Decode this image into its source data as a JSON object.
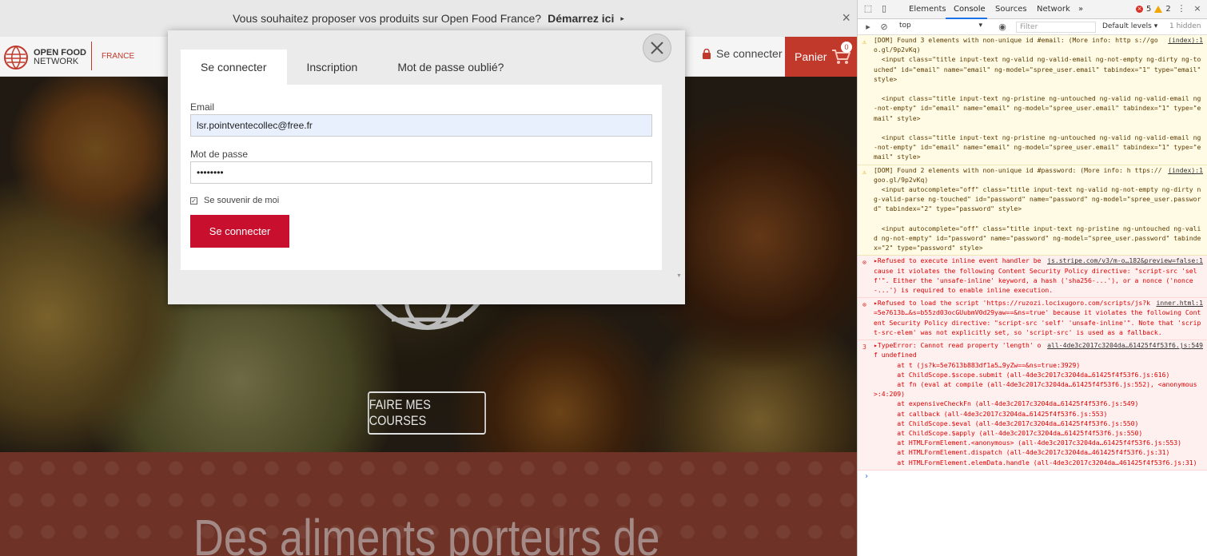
{
  "site": {
    "banner": {
      "text": "Vous souhaitez proposer vos produits sur Open Food France?",
      "cta": "Démarrez ici",
      "arrow": "▸",
      "close": "×"
    },
    "logo": {
      "line1": "OPEN FOOD",
      "line2": "NETWORK"
    },
    "country": "FRANCE",
    "login_link": "Se connecter",
    "cart": {
      "label": "Panier",
      "count": "0"
    },
    "hero_cta": "FAIRE MES COURSES",
    "tagline": "Des aliments porteurs de"
  },
  "modal": {
    "tabs": [
      "Se connecter",
      "Inscription",
      "Mot de passe oublié?"
    ],
    "active_tab": 0,
    "email_label": "Email",
    "email_value": "lsr.pointventecollec@free.fr",
    "password_label": "Mot de passe",
    "password_value": "••••••••",
    "remember_label": "Se souvenir de moi",
    "remember_checked": true,
    "submit_label": "Se connecter"
  },
  "devtools": {
    "tabs": [
      "Elements",
      "Console",
      "Sources",
      "Network",
      "»"
    ],
    "active_tab": "Console",
    "errors_count": "5",
    "warnings_count": "2",
    "context": "top",
    "filter_placeholder": "Filter",
    "levels": "Default levels ▾",
    "hidden": "1 hidden",
    "messages": [
      {
        "type": "warn",
        "icon": "⚠",
        "source": "(index):1",
        "text": "[DOM] Found 3 elements with non-unique id #email: (More info: http s://goo.gl/9p2vKq)\n  <input class=\"title input-text ng-valid ng-valid-email ng-not-empty ng-dirty ng-touched\" id=\"email\" name=\"email\" ng-model=\"spree_user.email\" tabindex=\"1\" type=\"email\" style>\n\n  <input class=\"title input-text ng-pristine ng-untouched ng-valid ng-valid-email ng-not-empty\" id=\"email\" name=\"email\" ng-model=\"spree_user.email\" tabindex=\"1\" type=\"email\" style>\n\n  <input class=\"title input-text ng-pristine ng-untouched ng-valid ng-valid-email ng-not-empty\" id=\"email\" name=\"email\" ng-model=\"spree_user.email\" tabindex=\"1\" type=\"email\" style>"
      },
      {
        "type": "warn",
        "icon": "⚠",
        "source": "(index):1",
        "text": "[DOM] Found 2 elements with non-unique id #password: (More info: h ttps://goo.gl/9p2vKq)\n  <input autocomplete=\"off\" class=\"title input-text ng-valid ng-not-empty ng-dirty ng-valid-parse ng-touched\" id=\"password\" name=\"password\" ng-model=\"spree_user.password\" tabindex=\"2\" type=\"password\" style>\n\n  <input autocomplete=\"off\" class=\"title input-text ng-pristine ng-untouched ng-valid ng-not-empty\" id=\"password\" name=\"password\" ng-model=\"spree_user.password\" tabindex=\"2\" type=\"password\" style>"
      },
      {
        "type": "error",
        "icon": "⊗",
        "source": "js.stripe.com/v3/m-o…182&preview=false:1",
        "text": "▸Refused to execute inline event handler because it violates the following Content Security Policy directive: \"script-src 'self'\". Either the 'unsafe-inline' keyword, a hash ('sha256-...'), or a nonce ('nonce-...') is required to enable inline execution."
      },
      {
        "type": "error",
        "icon": "⊗",
        "source": "inner.html:1",
        "text": "▸Refused to load the script 'https://ruzozi.locixugoro.com/scripts/js?k=5e7613b…&s=b55zd03ocGUubmV0d29yaw==&ns=true' because it violates the following Content Security Policy directive: \"script-src 'self' 'unsafe-inline'\". Note that 'script-src-elem' was not explicitly set, so 'script-src' is used as a fallback."
      },
      {
        "type": "error",
        "icon": "3",
        "source": "all-4de3c2017c3204da…61425f4f53f6.js:549",
        "text": "▸TypeError: Cannot read property 'length' of undefined\n      at t (js?k=5e7613b883df1a5…9yZw==&ns=true:3929)\n      at ChildScope.$scope.submit (all-4de3c2017c3204da…61425f4f53f6.js:616)\n      at fn (eval at compile (all-4de3c2017c3204da…61425f4f53f6.js:552), <anonymous>:4:209)\n      at expensiveCheckFn (all-4de3c2017c3204da…61425f4f53f6.js:549)\n      at callback (all-4de3c2017c3204da…61425f4f53f6.js:553)\n      at ChildScope.$eval (all-4de3c2017c3204da…61425f4f53f6.js:550)\n      at ChildScope.$apply (all-4de3c2017c3204da…61425f4f53f6.js:550)\n      at HTMLFormElement.<anonymous> (all-4de3c2017c3204da…61425f4f53f6.js:553)\n      at HTMLFormElement.dispatch (all-4de3c2017c3204da…461425f4f53f6.js:31)\n      at HTMLFormElement.elemData.handle (all-4de3c2017c3204da…461425f4f53f6.js:31)"
      }
    ],
    "prompt": "›"
  }
}
